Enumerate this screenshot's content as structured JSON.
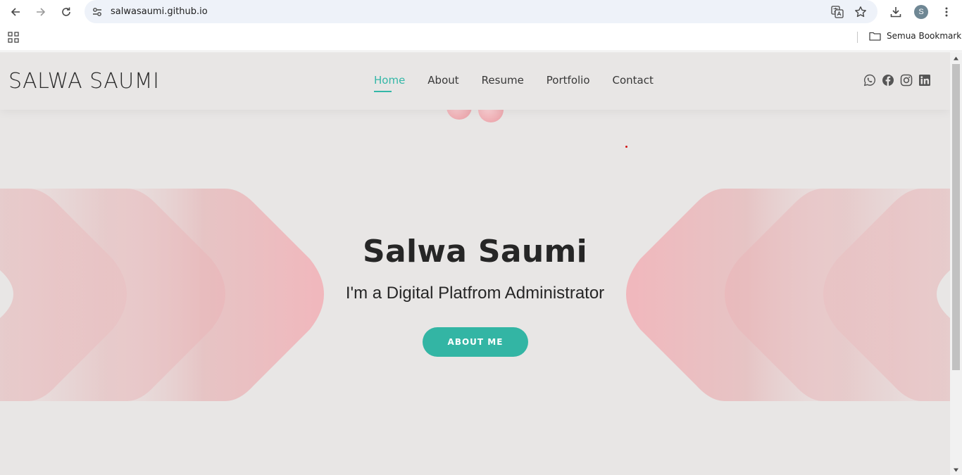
{
  "browser": {
    "url": "salwasaumi.github.io",
    "profile_initial": "S",
    "bookmarks_all_label": "Semua Bookmark"
  },
  "site": {
    "logo": "SALWA SAUMI",
    "nav": [
      "Home",
      "About",
      "Resume",
      "Portfolio",
      "Contact"
    ],
    "active_nav": "Home",
    "social_icons": [
      "whatsapp-icon",
      "facebook-icon",
      "instagram-icon",
      "linkedin-icon"
    ],
    "hero": {
      "title": "Salwa Saumi",
      "subtitle": "I'm a Digital Platfrom Administrator",
      "button": "ABOUT ME"
    }
  },
  "colors": {
    "accent": "#34b7a7",
    "page_bg": "#e8e6e5",
    "shape_pink": "#f2b8bd"
  }
}
